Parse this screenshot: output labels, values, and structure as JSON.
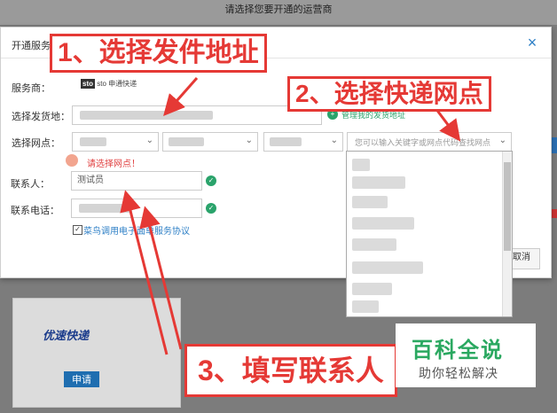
{
  "background": {
    "title": "请选择您要开通的运营商",
    "card": {
      "logo_text": "优速快递",
      "apply_label": "申请"
    }
  },
  "dialog": {
    "title": "开通服务商",
    "close_glyph": "×",
    "labels": {
      "provider": "服务商：",
      "ship_address": "选择发货地：",
      "outlet": "选择网点：",
      "contact": "联系人：",
      "phone": "联系电话："
    },
    "provider_logo": "sto 申通快递",
    "ship_address_hint": "管理我的发货地址",
    "outlet_search_placeholder": "您可以输入关键字或网点代码查找网点",
    "outlet_warning": "请选择网点！",
    "contact_value": "测试员",
    "agreement_label": "菜鸟调用电子面单服务协议",
    "cancel_label": "取消"
  },
  "annotations": {
    "step1": "1、选择发件地址",
    "step2": "2、选择快递网点",
    "step3": "3、填写联系人"
  },
  "watermark": {
    "main": "百科全说",
    "sub": "助你轻松解决"
  },
  "colors": {
    "accent": "#2d7fc6",
    "annotation": "#e53935",
    "success": "#2aa36b",
    "watermark": "#2aa860"
  }
}
